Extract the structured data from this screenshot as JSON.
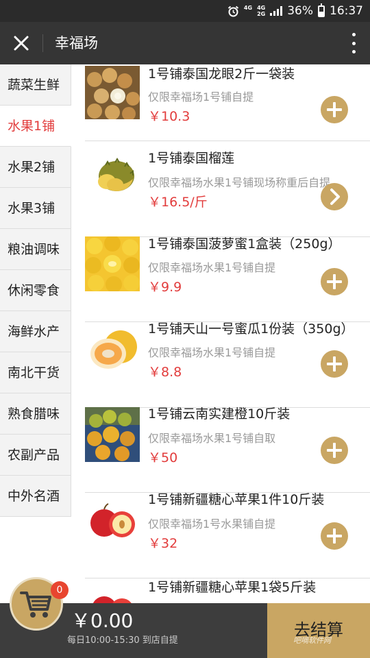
{
  "status_bar": {
    "network_top": "4G",
    "network_mid": "4G",
    "network_bot": "2G",
    "battery": "36%",
    "time": "16:37"
  },
  "header": {
    "title": "幸福场"
  },
  "sidebar": {
    "items": [
      {
        "label": "蔬菜生鲜",
        "active": false
      },
      {
        "label": "水果1铺",
        "active": true
      },
      {
        "label": "水果2铺",
        "active": false
      },
      {
        "label": "水果3铺",
        "active": false
      },
      {
        "label": "粮油调味",
        "active": false
      },
      {
        "label": "休闲零食",
        "active": false
      },
      {
        "label": "海鲜水产",
        "active": false
      },
      {
        "label": "南北干货",
        "active": false
      },
      {
        "label": "熟食腊味",
        "active": false
      },
      {
        "label": "农副产品",
        "active": false
      },
      {
        "label": "中外名酒",
        "active": false
      }
    ]
  },
  "products": [
    {
      "name": "1号铺泰国龙眼2斤一袋装",
      "note": "仅限幸福场1号铺自提",
      "price": "￥10.3",
      "action": "add"
    },
    {
      "name": "1号铺泰国榴莲",
      "note": "仅限幸福场水果1号铺现场称重后自提",
      "price": "￥16.5/斤",
      "action": "details"
    },
    {
      "name": "1号铺泰国菠萝蜜1盒装（250g）",
      "note": "仅限幸福场水果1号铺自提",
      "price": "￥9.9",
      "action": "add"
    },
    {
      "name": "1号铺天山一号蜜瓜1份装（350g）",
      "note": "仅限幸福场水果1号铺自提",
      "price": "￥8.8",
      "action": "add"
    },
    {
      "name": "1号铺云南实建橙10斤装",
      "note": "仅限幸福场水果1号铺自取",
      "price": "￥50",
      "action": "add"
    },
    {
      "name": "1号铺新疆糖心苹果1件10斤装",
      "note": "仅限幸福场1号水果铺自提",
      "price": "￥32",
      "action": "add"
    },
    {
      "name": "1号铺新疆糖心苹果1袋5斤装",
      "note": "",
      "price": "",
      "action": "none"
    }
  ],
  "cart": {
    "badge_count": "0",
    "total": "￥0.00",
    "hours": "每日10:00-15:30 到店自提",
    "checkout_label": "去结算"
  },
  "watermark": "吧嘀软件网",
  "colors": {
    "accent_gold": "#c9a663",
    "price_red": "#e23c3c",
    "header_dark": "#353535",
    "badge_red": "#e8452f"
  }
}
